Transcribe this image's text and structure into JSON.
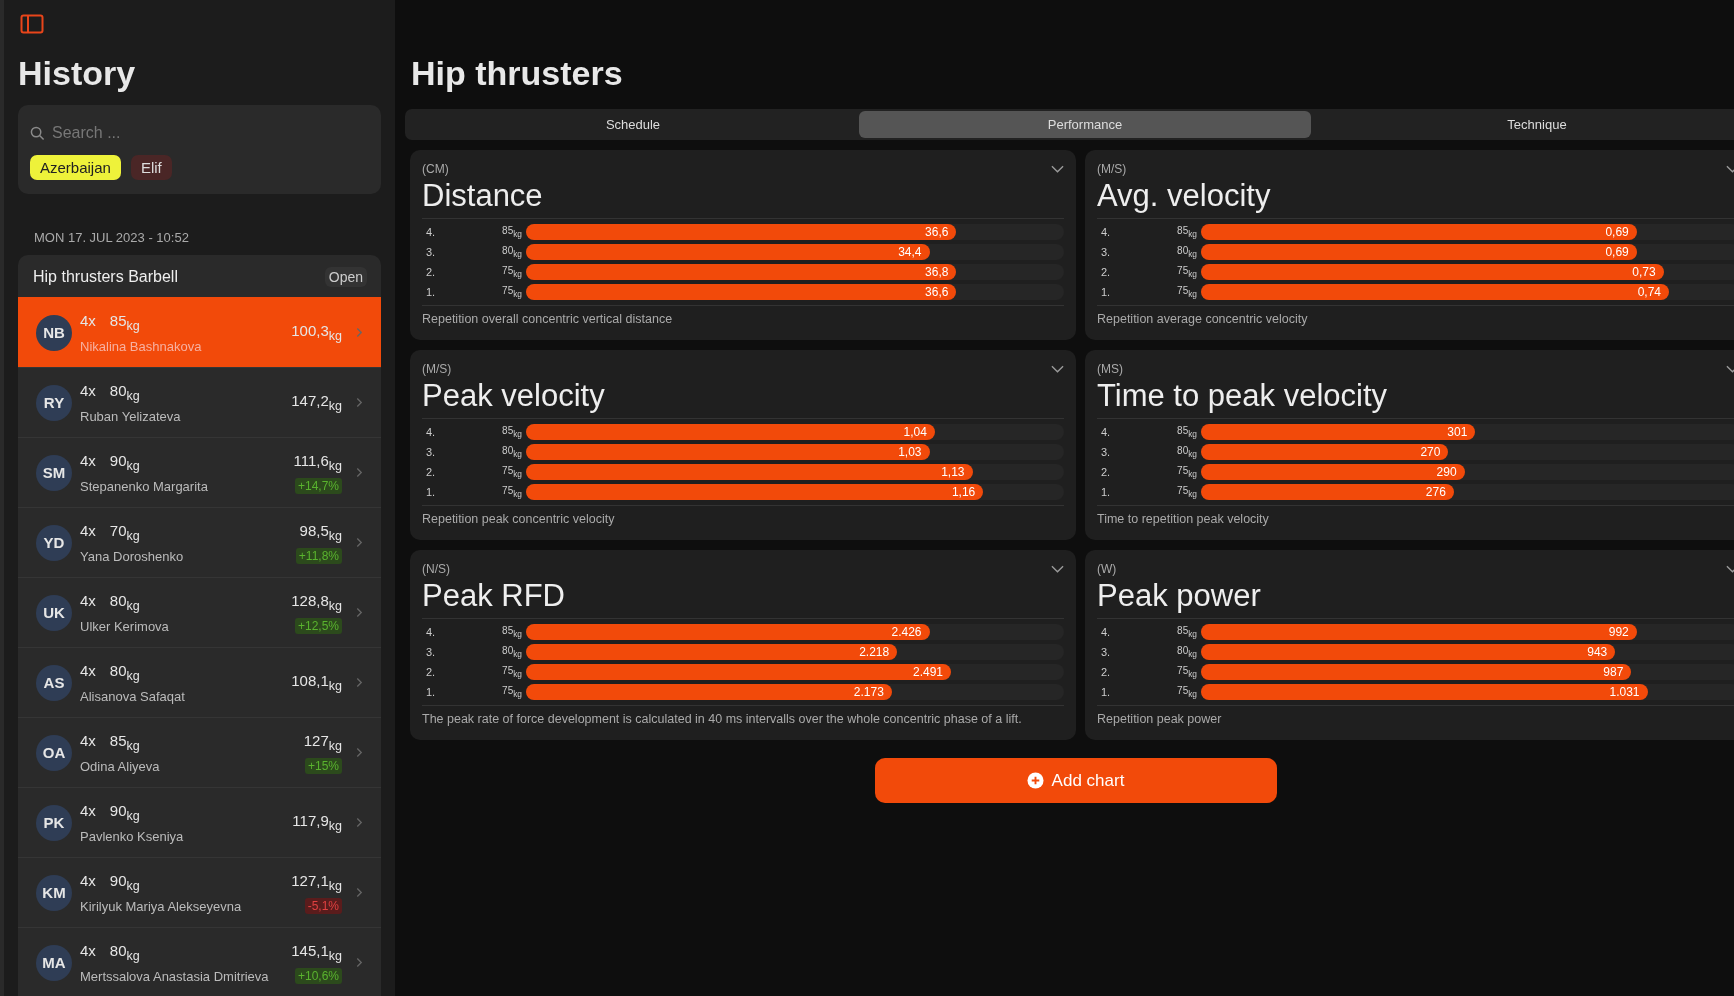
{
  "sidebar": {
    "title": "History",
    "search": {
      "placeholder": "Search ..."
    },
    "filters": [
      {
        "label": "Azerbaijan",
        "color": "#eef23a"
      },
      {
        "label": "Elif",
        "color": "#4a2626"
      }
    ],
    "date": "MON 17. JUL 2023 - 10:52",
    "session": {
      "title": "Hip thrusters Barbell",
      "action": "Open"
    },
    "entries": [
      {
        "initials": "NB",
        "reps": "4x",
        "weight": "85$_{kg}$",
        "name": "Nikalina Bashnakova",
        "total": "100,3$_{kg}$",
        "selected": true
      },
      {
        "initials": "RY",
        "reps": "4x",
        "weight": "80$_{kg}$",
        "name": "Ruban Yelizateva",
        "total": "147,2$_{kg}$",
        "selected": false
      },
      {
        "initials": "SM",
        "reps": "4x",
        "weight": "90$_{kg}$",
        "name": "Stepanenko Margarita",
        "total": "111,6$_{kg}$",
        "change": {
          "text": "+14,7%",
          "kind": "up"
        },
        "selected": false
      },
      {
        "initials": "YD",
        "reps": "4x",
        "weight": "70$_{kg}$",
        "name": "Yana Doroshenko",
        "total": "98,5$_{kg}$",
        "change": {
          "text": "+11,8%",
          "kind": "up"
        },
        "selected": false
      },
      {
        "initials": "UK",
        "reps": "4x",
        "weight": "80$_{kg}$",
        "name": "Ulker Kerimova",
        "total": "128,8$_{kg}$",
        "change": {
          "text": "+12,5%",
          "kind": "up"
        },
        "selected": false
      },
      {
        "initials": "AS",
        "reps": "4x",
        "weight": "80$_{kg}$",
        "name": "Alisanova Safaqat",
        "total": "108,1$_{kg}$",
        "selected": false
      },
      {
        "initials": "OA",
        "reps": "4x",
        "weight": "85$_{kg}$",
        "name": "Odina Aliyeva",
        "total": "127$_{kg}$",
        "change": {
          "text": "+15%",
          "kind": "up"
        },
        "selected": false
      },
      {
        "initials": "PK",
        "reps": "4x",
        "weight": "90$_{kg}$",
        "name": "Pavlenko Kseniya",
        "total": "117,9$_{kg}$",
        "selected": false
      },
      {
        "initials": "KM",
        "reps": "4x",
        "weight": "90$_{kg}$",
        "name": "Kirilyuk Mariya Alekseyevna",
        "total": "127,1$_{kg}$",
        "change": {
          "text": "-5,1%",
          "kind": "down"
        },
        "selected": false
      },
      {
        "initials": "MA",
        "reps": "4x",
        "weight": "80$_{kg}$",
        "name": "Mertssalova Anastasia Dmitrieva",
        "total": "145,1$_{kg}$",
        "change": {
          "text": "+10,6%",
          "kind": "up"
        },
        "selected": false
      }
    ]
  },
  "main": {
    "title": "Hip thrusters",
    "tabs": [
      {
        "label": "Schedule",
        "selected": false
      },
      {
        "label": "Performance",
        "selected": true
      },
      {
        "label": "Technique",
        "selected": false
      }
    ],
    "cards": [
      {
        "unit": "(CM)",
        "title": "Distance",
        "description": "Repetition overall concentric vertical distance",
        "rows": [
          {
            "rep": "4.",
            "weight": "85$_{kg}$",
            "value": "36,6",
            "level": 0.8
          },
          {
            "rep": "3.",
            "weight": "80$_{kg}$",
            "value": "34,4",
            "level": 0.75
          },
          {
            "rep": "2.",
            "weight": "75$_{kg}$",
            "value": "36,8",
            "level": 0.8
          },
          {
            "rep": "1.",
            "weight": "75$_{kg}$",
            "value": "36,6",
            "level": 0.8
          }
        ]
      },
      {
        "unit": "(M/S)",
        "title": "Avg. velocity",
        "description": "Repetition average concentric velocity",
        "rows": [
          {
            "rep": "4.",
            "weight": "85$_{kg}$",
            "value": "0,69",
            "level": 0.81
          },
          {
            "rep": "3.",
            "weight": "80$_{kg}$",
            "value": "0,69",
            "level": 0.81
          },
          {
            "rep": "2.",
            "weight": "75$_{kg}$",
            "value": "0,73",
            "level": 0.86
          },
          {
            "rep": "1.",
            "weight": "75$_{kg}$",
            "value": "0,74",
            "level": 0.87
          }
        ]
      },
      {
        "unit": "(M/S)",
        "title": "Peak velocity",
        "description": "Repetition peak concentric velocity",
        "rows": [
          {
            "rep": "4.",
            "weight": "85$_{kg}$",
            "value": "1,04",
            "level": 0.76
          },
          {
            "rep": "3.",
            "weight": "80$_{kg}$",
            "value": "1,03",
            "level": 0.75
          },
          {
            "rep": "2.",
            "weight": "75$_{kg}$",
            "value": "1,13",
            "level": 0.83
          },
          {
            "rep": "1.",
            "weight": "75$_{kg}$",
            "value": "1,16",
            "level": 0.85
          }
        ]
      },
      {
        "unit": "(MS)",
        "title": "Time to peak velocity",
        "description": "Time to repetition peak velocity",
        "rows": [
          {
            "rep": "4.",
            "weight": "85$_{kg}$",
            "value": "301",
            "level": 0.51
          },
          {
            "rep": "3.",
            "weight": "80$_{kg}$",
            "value": "270",
            "level": 0.46
          },
          {
            "rep": "2.",
            "weight": "75$_{kg}$",
            "value": "290",
            "level": 0.49
          },
          {
            "rep": "1.",
            "weight": "75$_{kg}$",
            "value": "276",
            "level": 0.47
          }
        ]
      },
      {
        "unit": "(N/S)",
        "title": "Peak RFD",
        "description": "The peak rate of force development is calculated in 40 ms intervalls over the whole concentric phase of a lift.",
        "rows": [
          {
            "rep": "4.",
            "weight": "85$_{kg}$",
            "value": "2.426",
            "level": 0.75
          },
          {
            "rep": "3.",
            "weight": "80$_{kg}$",
            "value": "2.218",
            "level": 0.69
          },
          {
            "rep": "2.",
            "weight": "75$_{kg}$",
            "value": "2.491",
            "level": 0.79
          },
          {
            "rep": "1.",
            "weight": "75$_{kg}$",
            "value": "2.173",
            "level": 0.68
          }
        ]
      },
      {
        "unit": "(W)",
        "title": "Peak power",
        "description": "Repetition peak power",
        "rows": [
          {
            "rep": "4.",
            "weight": "85$_{kg}$",
            "value": "992",
            "level": 0.81
          },
          {
            "rep": "3.",
            "weight": "80$_{kg}$",
            "value": "943",
            "level": 0.77
          },
          {
            "rep": "2.",
            "weight": "75$_{kg}$",
            "value": "987",
            "level": 0.8
          },
          {
            "rep": "1.",
            "weight": "75$_{kg}$",
            "value": "1.031",
            "level": 0.83
          }
        ]
      }
    ],
    "add_button": "Add chart"
  }
}
